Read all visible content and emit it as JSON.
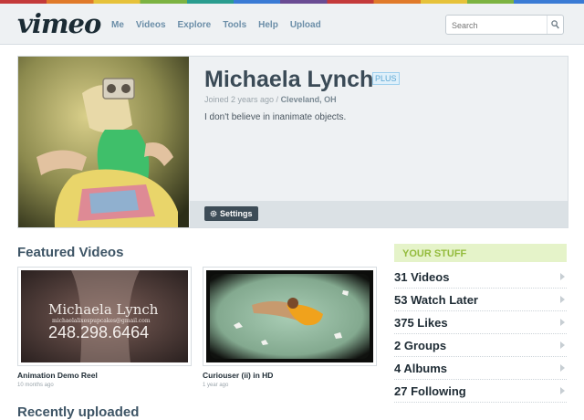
{
  "header": {
    "logo": "vimeo",
    "nav": [
      "Me",
      "Videos",
      "Explore",
      "Tools",
      "Help",
      "Upload"
    ],
    "search_placeholder": "Search"
  },
  "profile": {
    "name": "Michaela Lynch",
    "badge": "PLUS",
    "joined_prefix": "Joined 2 years ago / ",
    "location": "Cleveland, OH",
    "bio": "I don't believe in inanimate objects.",
    "settings_label": "Settings"
  },
  "featured": {
    "heading": "Featured Videos",
    "videos": [
      {
        "title": "Animation Demo Reel",
        "age": "10 months ago",
        "thumb_name": "Michaela Lynch",
        "thumb_email": "michaelalixespupcakes@gmail.com",
        "thumb_phone": "248.298.6464"
      },
      {
        "title": "Curiouser (ii) in HD",
        "age": "1 year ago"
      }
    ]
  },
  "recent_heading": "Recently uploaded",
  "your_stuff": {
    "heading": "YOUR STUFF",
    "items": [
      "31 Videos",
      "53 Watch Later",
      "375 Likes",
      "2 Groups",
      "4 Albums",
      "27 Following"
    ]
  }
}
